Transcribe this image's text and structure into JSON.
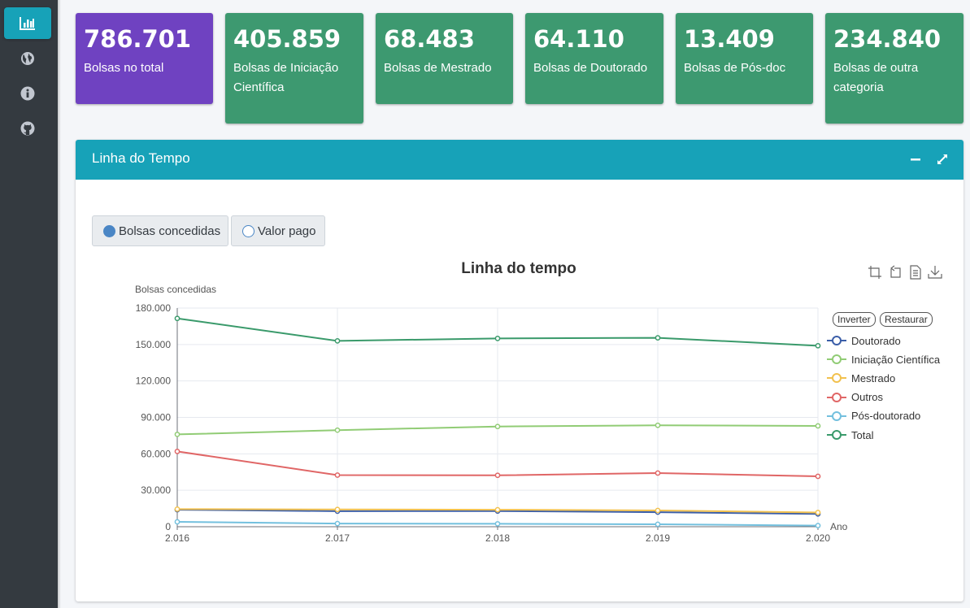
{
  "sidebar": {
    "items": [
      {
        "icon": "bar-chart-icon",
        "active": true
      },
      {
        "icon": "globe-icon",
        "active": false
      },
      {
        "icon": "info-icon",
        "active": false
      },
      {
        "icon": "github-icon",
        "active": false
      }
    ]
  },
  "cards": [
    {
      "value": "786.701",
      "label": "Bolsas no total",
      "color": "#6f42c1"
    },
    {
      "value": "405.859",
      "label": "Bolsas de Iniciação Científica",
      "color": "#3d9970"
    },
    {
      "value": "68.483",
      "label": "Bolsas de Mestrado",
      "color": "#3d9970"
    },
    {
      "value": "64.110",
      "label": "Bolsas de Doutorado",
      "color": "#3d9970"
    },
    {
      "value": "13.409",
      "label": "Bolsas de Pós-doc",
      "color": "#3d9970"
    },
    {
      "value": "234.840",
      "label": "Bolsas de outra categoria",
      "color": "#3d9970"
    }
  ],
  "panel": {
    "title": "Linha do Tempo",
    "header_color": "#17a2b8",
    "tools": [
      "minimize-icon",
      "expand-icon"
    ]
  },
  "toggle": {
    "options": [
      "Bolsas concedidas",
      "Valor pago"
    ],
    "selected": "Bolsas concedidas"
  },
  "chart_toolbar": {
    "icons": [
      "zoom-icon",
      "zoom-reset-icon",
      "data-view-icon",
      "download-icon"
    ],
    "buttons": [
      "Inverter",
      "Restaurar"
    ]
  },
  "chart_data": {
    "type": "line",
    "title": "Linha do tempo",
    "ylabel": "Bolsas concedidas",
    "xlabel": "Ano",
    "x": [
      "2.016",
      "2.017",
      "2.018",
      "2.019",
      "2.020"
    ],
    "ylim": [
      0,
      180000
    ],
    "yticks": [
      "0",
      "30.000",
      "60.000",
      "90.000",
      "120.000",
      "150.000",
      "180.000"
    ],
    "grid": true,
    "legend_position": "right",
    "series": [
      {
        "name": "Doutorado",
        "color": "#3b5ea8",
        "values": [
          14000,
          12800,
          12900,
          12000,
          10500
        ]
      },
      {
        "name": "Iniciação Científica",
        "color": "#91cc75",
        "values": [
          76000,
          79500,
          82500,
          83500,
          83000
        ]
      },
      {
        "name": "Mestrado",
        "color": "#f2c14e",
        "values": [
          14500,
          14200,
          14000,
          13400,
          11700
        ]
      },
      {
        "name": "Outros",
        "color": "#e06666",
        "values": [
          62000,
          42500,
          42300,
          44200,
          41500
        ]
      },
      {
        "name": "Pós-doutorado",
        "color": "#73c0de",
        "values": [
          4000,
          2600,
          2400,
          2000,
          900
        ]
      },
      {
        "name": "Total",
        "color": "#3a9a6b",
        "values": [
          171500,
          153000,
          155000,
          155500,
          149000
        ]
      }
    ]
  }
}
